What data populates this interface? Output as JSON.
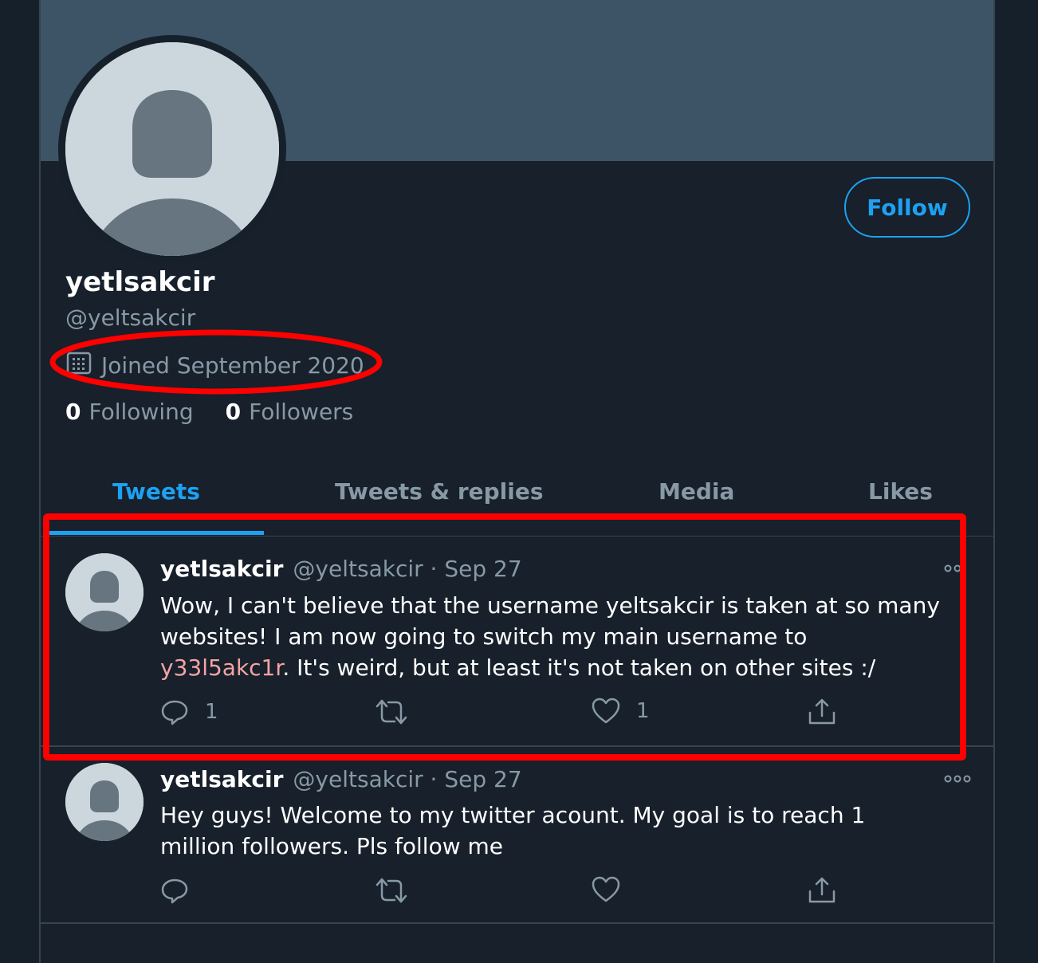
{
  "profile": {
    "display_name": "yetlsakcir",
    "handle": "@yeltsakcir",
    "joined": "Joined September 2020",
    "following_count": "0",
    "following_label": "Following",
    "followers_count": "0",
    "followers_label": "Followers",
    "follow_label": "Follow"
  },
  "tabs": [
    {
      "label": "Tweets",
      "active": true
    },
    {
      "label": "Tweets & replies",
      "active": false
    },
    {
      "label": "Media",
      "active": false
    },
    {
      "label": "Likes",
      "active": false
    }
  ],
  "tweets": [
    {
      "name": "yetlsakcir",
      "meta": "@yeltsakcir · Sep 27",
      "text_before": "Wow, I can't believe that the username yeltsakcir is taken at so many websites! I am now going to switch my main username to ",
      "text_highlight": "y33l5akc1r",
      "text_after": ". It's weird, but at least it's not taken on other sites :/",
      "reply_count": "1",
      "retweet_count": "",
      "like_count": "1"
    },
    {
      "name": "yetlsakcir",
      "meta": "@yeltsakcir · Sep 27",
      "text_before": "Hey guys! Welcome to my twitter acount. My goal is to reach 1 million followers. Pls follow me",
      "text_highlight": "",
      "text_after": "",
      "reply_count": "",
      "retweet_count": "",
      "like_count": ""
    }
  ],
  "colors": {
    "background": "#15202b",
    "banner": "#3d5466",
    "accent": "#1da1f2",
    "muted": "#8899a6",
    "annotation": "#ff0000"
  },
  "icons": [
    "calendar-icon",
    "reply-icon",
    "retweet-icon",
    "like-icon",
    "share-icon",
    "more-icon",
    "default-avatar-icon"
  ]
}
